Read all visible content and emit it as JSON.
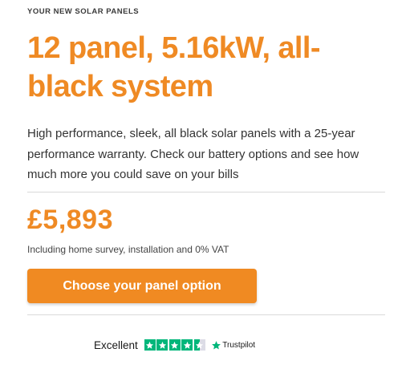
{
  "eyebrow": "YOUR NEW SOLAR PANELS",
  "title": "12 panel, 5.16kW, all-black system",
  "description": "High performance, sleek, all black solar panels with a 25-year performance warranty. Check our battery options and see how much more you could save on your bills",
  "price": "£5,893",
  "price_note": "Including home survey, installation and 0% VAT",
  "cta": {
    "label": "Choose your panel option"
  },
  "trustpilot": {
    "label": "Excellent",
    "rating_stars": 4.5,
    "brand": "Trustpilot"
  },
  "colors": {
    "accent": "#ef8a24",
    "button": "#f08a22",
    "trustpilot_green": "#00b67a"
  },
  "icons": {
    "rating": "star-icon",
    "trustpilot_logo": "trustpilot-star-icon"
  }
}
